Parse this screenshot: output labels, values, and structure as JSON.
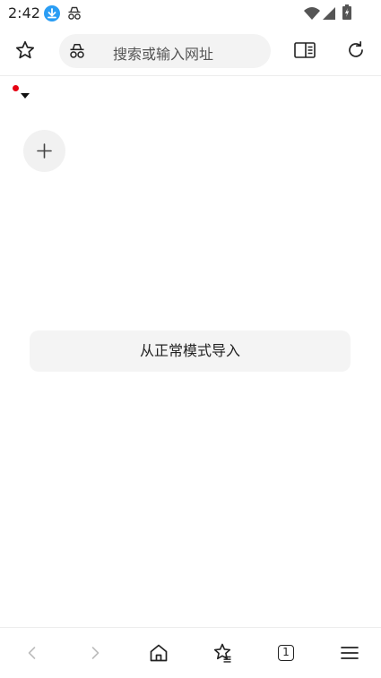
{
  "status_bar": {
    "time": "2:42",
    "icons": [
      "download-icon",
      "incognito-icon",
      "wifi-icon",
      "signal-icon",
      "battery-icon"
    ]
  },
  "toolbar": {
    "address_placeholder": "搜索或输入网址",
    "icons": [
      "star-icon",
      "incognito-icon",
      "reader-mode-icon",
      "reload-icon"
    ]
  },
  "content": {
    "import_label": "从正常模式导入",
    "icons": [
      "plus-icon",
      "dropdown-caret-icon"
    ]
  },
  "bottom_nav": {
    "tab_count": "1",
    "icons": [
      "back-icon",
      "forward-icon",
      "home-icon",
      "bookmarks-icon",
      "tabs-icon",
      "menu-icon"
    ]
  },
  "colors": {
    "accent_blue": "#2a9df4",
    "notification_red": "#e60012",
    "pill_background": "#f3f3f3"
  }
}
